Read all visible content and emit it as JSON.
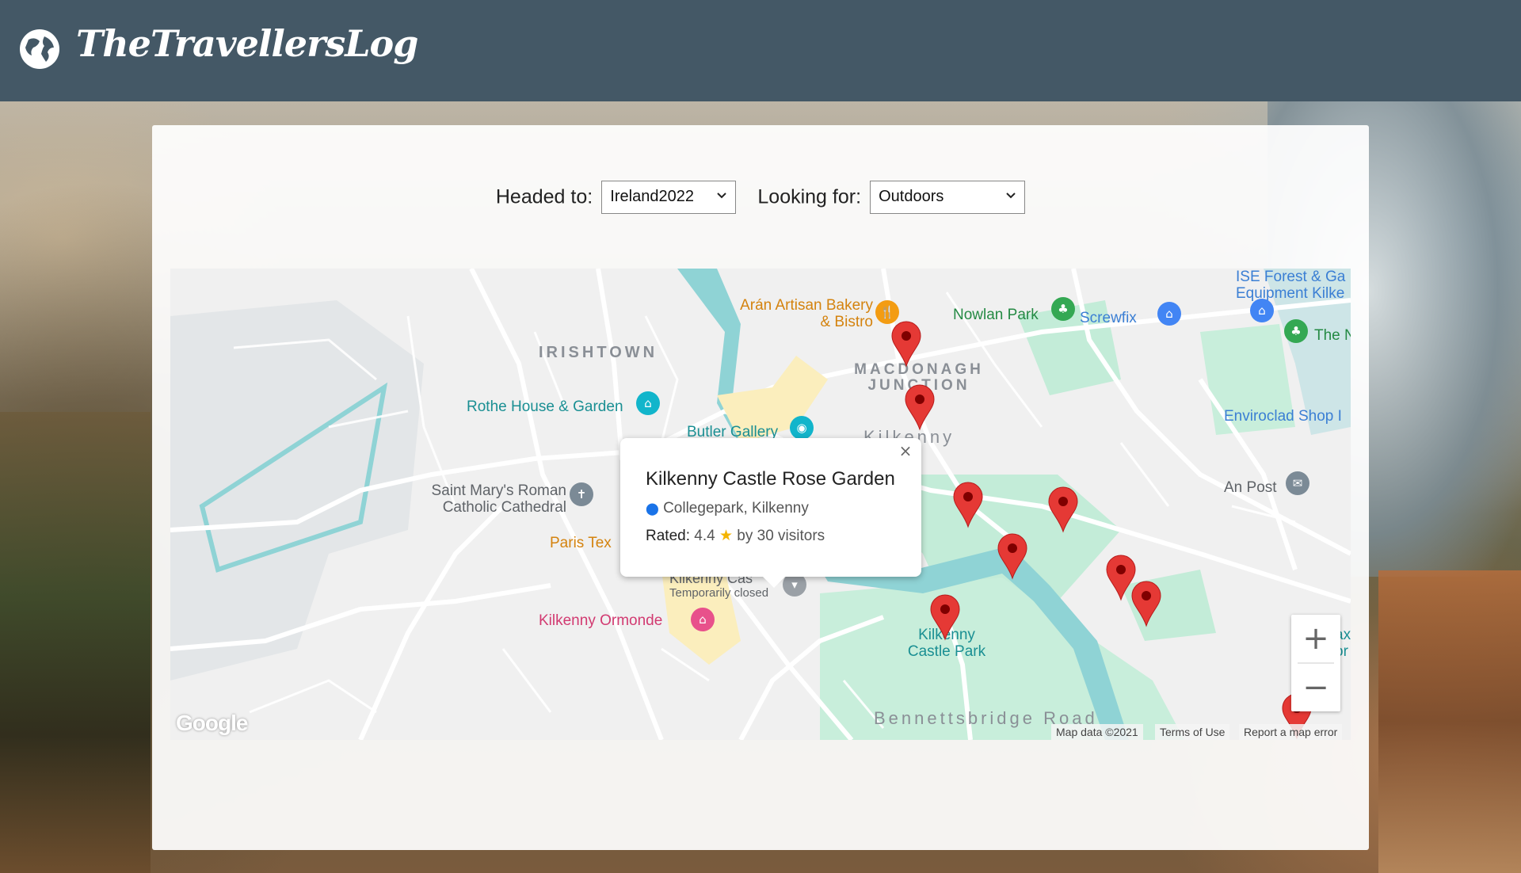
{
  "brand": {
    "title": "TheTravellersLog",
    "icon": "globe-icon"
  },
  "filters": {
    "headed_label": "Headed to:",
    "headed_value": "Ireland2022",
    "looking_label": "Looking for:",
    "looking_value": "Outdoors"
  },
  "map": {
    "areas": {
      "irishtown": "IRISHTOWN",
      "macdonagh": "MACDONAGH JUNCTION",
      "kilkenny": "Kilkenny",
      "bennettsbridge": "Bennettsbridge Road"
    },
    "pois": {
      "aran_bakery": "Arán Artisan Bakery & Bistro",
      "nowlan_park": "Nowlan Park",
      "screwfix": "Screwfix",
      "ise_forest": "ISE Forest & Ga Equipment Kilke",
      "the_n": "The N",
      "rothe_house": "Rothe House & Garden",
      "butler_gallery": "Butler Gallery",
      "envirocrad": "Enviroclad Shop I",
      "an_post": "An Post",
      "st_marys": "Saint Mary's Roman Catholic Cathedral",
      "paris_tex": "Paris Tex",
      "kilkenny_castle": "Kilkenny Cas",
      "temporarily_closed": "Temporarily closed",
      "kilkenny_ormonde": "Kilkenny Ormonde",
      "castle_park": "Kilkenny Castle Park",
      "partial_right": "ax or"
    },
    "infowindow": {
      "title": "Kilkenny Castle Rose Garden",
      "address": "Collegepark, Kilkenny",
      "rated_label": "Rated:",
      "rating": "4.4",
      "visitors": "by 30 visitors",
      "close": "×"
    },
    "zoom_in": "+",
    "zoom_out": "−",
    "google": "Google",
    "map_data": "Map data ©2021",
    "terms": "Terms of Use",
    "report": "Report a map error"
  },
  "colors": {
    "header": "#445866",
    "marker": "#e53935",
    "water": "#aadadd",
    "park": "#c3ecd8"
  }
}
